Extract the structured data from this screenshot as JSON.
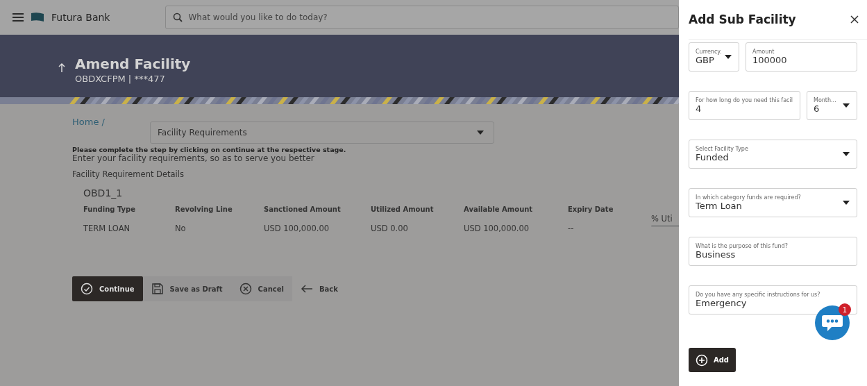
{
  "header": {
    "brand": "Futura Bank",
    "search": {
      "placeholder": "What would you like to do today?"
    }
  },
  "banner": {
    "title": "Amend Facility",
    "subtitle": "OBDXCFPM | ***477"
  },
  "breadcrumb": "Home /",
  "stage_select": {
    "value": "Facility Requirements"
  },
  "instruction": "Please complete the step by clicking on continue at the respective stage.",
  "intro": "Enter your facility requirements, so as to serve you better",
  "section_title": "Facility Requirement Details",
  "facility": {
    "name": "OBD1_1",
    "columns": [
      "Funding Type",
      "Revolving Line",
      "Sanctioned Amount",
      "Utilized Amount",
      "Available Amount",
      "Expiry Date"
    ],
    "rows": [
      [
        "TERM LOAN",
        "No",
        "USD 100,000.00",
        "USD 0.00",
        "USD 100,000.00",
        "--"
      ]
    ],
    "column_7": "% Uti"
  },
  "actions": [
    {
      "label": "Continue",
      "kind": "primary"
    },
    {
      "label": "Save as Draft",
      "kind": "draft"
    },
    {
      "label": "Cancel",
      "kind": "cancel"
    },
    {
      "label": "Back",
      "kind": "back"
    }
  ],
  "panel": {
    "title": "Add Sub Facility",
    "field_groups": [
      {
        "fields": [
          {
            "label": "Currency.",
            "value": "GBP",
            "kind": "select"
          },
          {
            "label": "Amount",
            "value": "100000",
            "kind": "text"
          }
        ]
      },
      {
        "fields": [
          {
            "label": "For how long do you need this facil",
            "value": "4",
            "kind": "text"
          },
          {
            "label": "Month...",
            "value": "6",
            "kind": "select"
          }
        ]
      },
      {
        "fields": [
          {
            "label": "Select Facility Type",
            "value": "Funded",
            "kind": "select"
          }
        ]
      },
      {
        "fields": [
          {
            "label": "In which category funds are required?",
            "value": "Term Loan",
            "kind": "select"
          }
        ]
      },
      {
        "fields": [
          {
            "label": "What is the purpose of this fund?",
            "value": "Business",
            "kind": "text"
          }
        ]
      },
      {
        "fields": [
          {
            "label": "Do you have any specific instructions for us?",
            "value": "Emergency",
            "kind": "text"
          }
        ]
      }
    ],
    "add_button": "Add"
  },
  "chat": {
    "badge": "1"
  }
}
